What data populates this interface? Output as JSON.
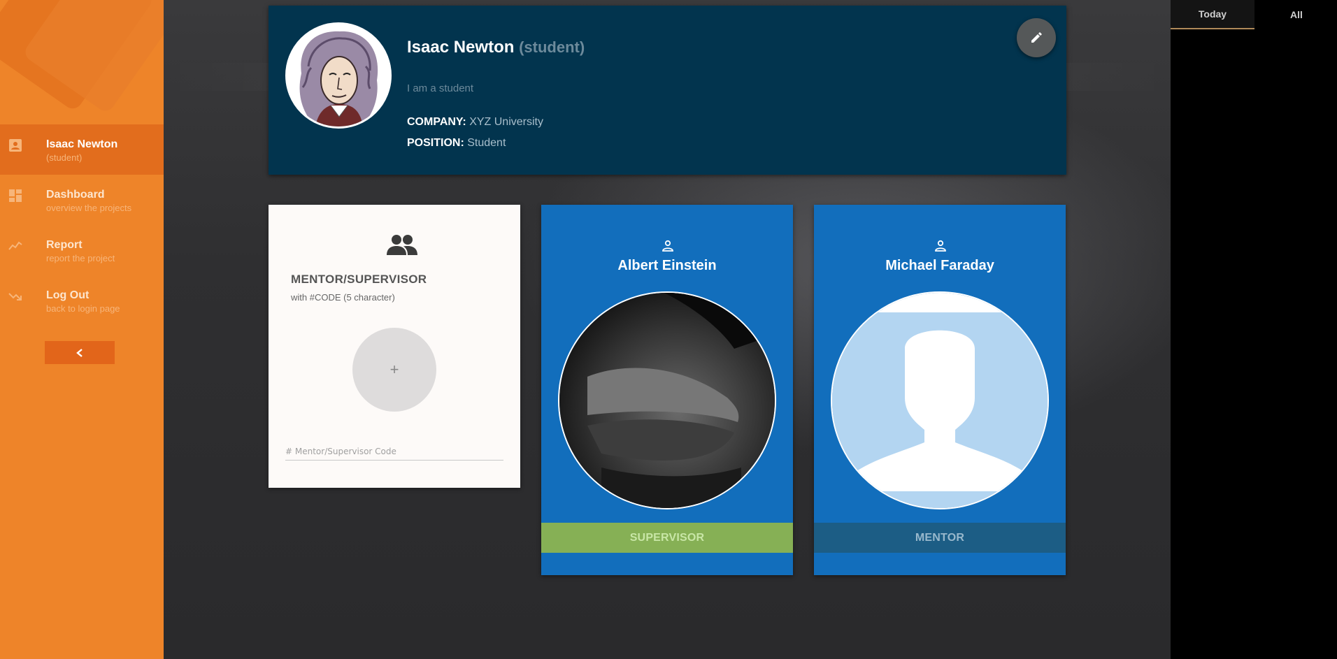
{
  "sidebar": {
    "items": [
      {
        "title": "Isaac Newton",
        "sub": "(student)",
        "icon": "contact-card-icon"
      },
      {
        "title": "Dashboard",
        "sub": "overview the projects",
        "icon": "dashboard-icon"
      },
      {
        "title": "Report",
        "sub": "report the project",
        "icon": "trending-icon"
      },
      {
        "title": "Log Out",
        "sub": "back to login page",
        "icon": "logout-arrow-icon"
      }
    ],
    "collapse_icon": "chevron-left-icon"
  },
  "profile": {
    "name": "Isaac Newton",
    "role": "(student)",
    "bio": "I am a student",
    "company_label": "COMPANY:",
    "company_value": "XYZ University",
    "position_label": "POSITION:",
    "position_value": "Student",
    "edit_icon": "pencil-icon"
  },
  "add_card": {
    "icon": "group-icon",
    "title": "MENTOR/SUPERVISOR",
    "subtitle": "with #CODE (5 character)",
    "plus": "+",
    "input_placeholder": "# Mentor/Supervisor Code"
  },
  "people": [
    {
      "name": "Albert Einstein",
      "role_badge": "SUPERVISOR",
      "icon": "person-outline-icon"
    },
    {
      "name": "Michael Faraday",
      "role_badge": "MENTOR",
      "icon": "person-outline-icon"
    }
  ],
  "right_panel": {
    "tabs": [
      "Today",
      "All"
    ]
  },
  "colors": {
    "sidebar": "#ee8429",
    "profile_bg": "#02344e",
    "card_blue": "#126ebc",
    "supervisor_badge": "#86b055",
    "mentor_badge": "#1c5d85"
  }
}
